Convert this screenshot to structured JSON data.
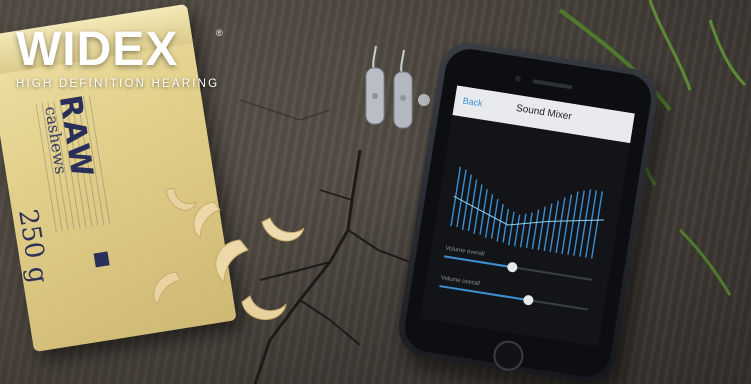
{
  "brand": {
    "name": "WIDEX",
    "registered_mark": "®",
    "tagline": "HIGH DEFINITION HEARING"
  },
  "bag": {
    "product": "RAW",
    "subtitle": "cashews",
    "weight": "250 g"
  },
  "phone_app": {
    "nav_back": "Back",
    "screen_title": "Sound Mixer",
    "sliders": [
      {
        "label": "Volume overall",
        "value_fraction": 0.46
      },
      {
        "label": "Volume overall",
        "value_fraction": 0.6
      }
    ]
  },
  "colors": {
    "accent": "#3b8fd0",
    "logo": "#ffffff",
    "bag_print": "#2a2f5a"
  }
}
